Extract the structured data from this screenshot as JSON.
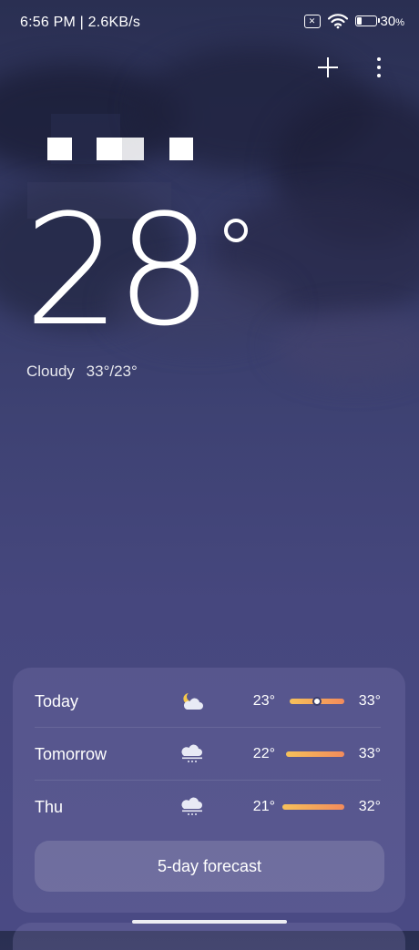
{
  "status_bar": {
    "time_speed": "6:56 PM | 2.6KB/s",
    "sim_icon": "no-sim-icon",
    "wifi_icon": "wifi-icon",
    "battery_percent": "30",
    "battery_unit": "%",
    "battery_level": 0.3
  },
  "toolbar": {
    "add_icon": "plus-icon",
    "more_icon": "more-vertical-icon"
  },
  "current": {
    "temperature": "28",
    "condition": "Cloudy",
    "range": "33°/23°"
  },
  "forecast": {
    "rows": [
      {
        "day": "Today",
        "icon": "partly-cloudy-night-icon",
        "low": "23°",
        "high": "33°",
        "bar_start": 0.0,
        "bar_end": 1.0,
        "current_marker": 0.5
      },
      {
        "day": "Tomorrow",
        "icon": "cloudy-rain-icon",
        "low": "22°",
        "high": "33°",
        "bar_start": 0.0,
        "bar_end": 1.0
      },
      {
        "day": "Thu",
        "icon": "cloudy-rain-icon",
        "low": "21°",
        "high": "32°",
        "bar_start": 0.0,
        "bar_end": 1.0
      }
    ],
    "button_label": "5-day forecast"
  },
  "colors": {
    "background_top": "#2a2f52",
    "background_bottom": "#4a4a84",
    "bar_start": "#f6c15a",
    "bar_end": "#f38b5b"
  }
}
